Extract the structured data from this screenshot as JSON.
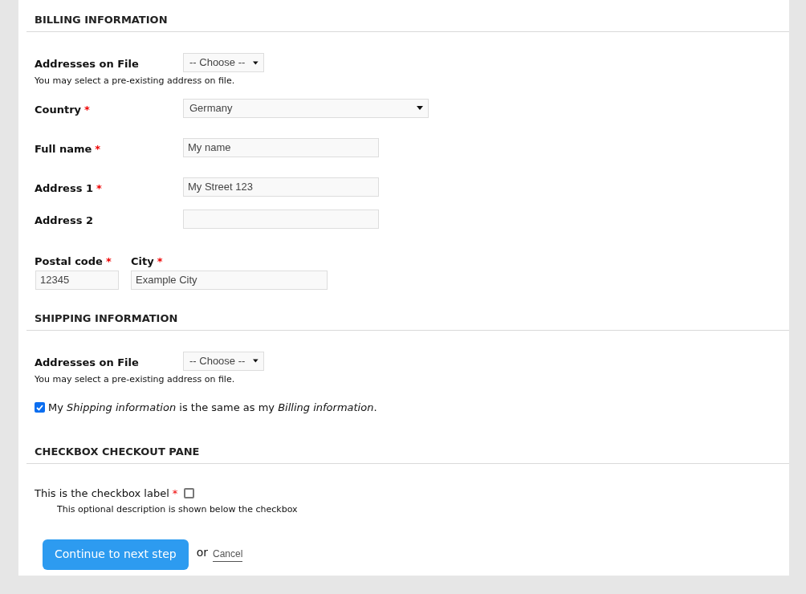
{
  "billing": {
    "heading": "BILLING INFORMATION",
    "addresses": {
      "label": "Addresses on File",
      "value": "-- Choose --",
      "help": "You may select a pre-existing address on file."
    },
    "country": {
      "label": "Country",
      "required_mark": "*",
      "value": "Germany"
    },
    "full_name": {
      "label": "Full name",
      "required_mark": "*",
      "value": "My name"
    },
    "address_1": {
      "label": "Address 1",
      "required_mark": "*",
      "value": "My Street 123"
    },
    "address_2": {
      "label": "Address 2"
    },
    "postal_code": {
      "label": "Postal code",
      "required_mark": "*",
      "value": "12345"
    },
    "city": {
      "label": "City",
      "required_mark": "*",
      "value": "Example City"
    }
  },
  "shipping": {
    "heading": "SHIPPING INFORMATION",
    "addresses": {
      "label": "Addresses on File",
      "value": "-- Choose --",
      "help": "You may select a pre-existing address on file."
    },
    "same_as_billing": {
      "checked": true,
      "label": "My *Shipping information* is the same as my *Billing information*."
    }
  },
  "checkbox_pane": {
    "heading": "CHECKBOX CHECKOUT PANE",
    "field": {
      "label": "This is the checkbox label",
      "required_mark": "*",
      "checked": false,
      "description": "This optional description is shown below the checkbox"
    }
  },
  "actions": {
    "continue": "Continue to next step",
    "or": "or",
    "cancel": "Cancel"
  }
}
